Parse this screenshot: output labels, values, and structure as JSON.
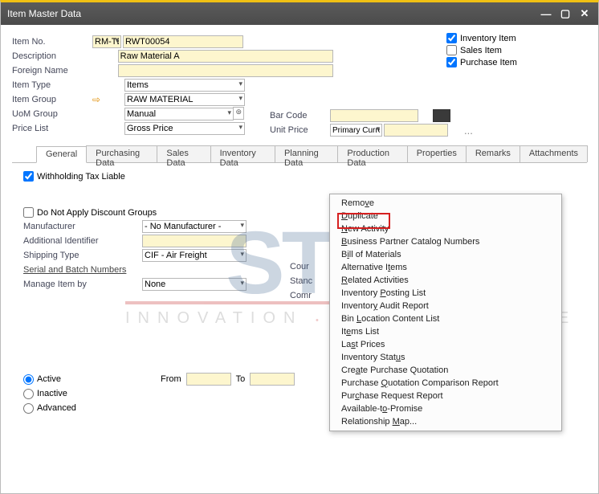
{
  "window": {
    "title": "Item Master Data"
  },
  "header": {
    "item_no_lbl": "Item No.",
    "item_no_prefix": "RM-TB",
    "item_no": "RWT00054",
    "desc_lbl": "Description",
    "desc": "Raw Material A",
    "foreign_lbl": "Foreign Name",
    "foreign": "",
    "type_lbl": "Item Type",
    "type": "Items",
    "group_lbl": "Item Group",
    "group": "RAW MATERIAL",
    "uom_lbl": "UoM Group",
    "uom": "Manual",
    "pricelist_lbl": "Price List",
    "pricelist": "Gross Price",
    "barcode_lbl": "Bar Code",
    "barcode": "",
    "unitprice_lbl": "Unit Price",
    "unitprice_cur": "Primary Curre",
    "unitprice": ""
  },
  "checks": {
    "inv_lbl": "Inventory Item",
    "sales_lbl": "Sales Item",
    "purch_lbl": "Purchase Item"
  },
  "tabs": {
    "general": "General",
    "purchasing": "Purchasing Data",
    "sales": "Sales Data",
    "inventory": "Inventory Data",
    "planning": "Planning Data",
    "production": "Production Data",
    "properties": "Properties",
    "remarks": "Remarks",
    "attachments": "Attachments"
  },
  "general": {
    "withhold_lbl": "Withholding Tax Liable",
    "nodisc_lbl": "Do Not Apply Discount Groups",
    "mfr_lbl": "Manufacturer",
    "mfr": "- No Manufacturer -",
    "addid_lbl": "Additional Identifier",
    "addid": "",
    "ship_lbl": "Shipping Type",
    "ship": "CIF - Air Freight",
    "serial_link": "Serial and Batch Numbers",
    "manage_lbl": "Manage Item by",
    "manage": "None",
    "active_lbl": "Active",
    "inactive_lbl": "Inactive",
    "advanced_lbl": "Advanced",
    "from_lbl": "From",
    "to_lbl": "To",
    "country_lbl": "Cour",
    "stand_lbl": "Stanc",
    "comm_lbl": "Comr"
  },
  "context_menu": {
    "items": [
      {
        "html": "Remo<u>v</u>e"
      },
      {
        "html": "<u>D</u>uplicate"
      },
      {
        "html": "<u>N</u>ew Activity"
      },
      {
        "html": "<u>B</u>usiness Partner Catalog Numbers"
      },
      {
        "html": "B<u>i</u>ll of Materials"
      },
      {
        "html": "Alternative I<u>t</u>ems"
      },
      {
        "html": "<u>R</u>elated Activities"
      },
      {
        "html": "Inventory <u>P</u>osting List"
      },
      {
        "html": "Inventor<u>y</u> Audit Report"
      },
      {
        "html": "Bin <u>L</u>ocation Content List"
      },
      {
        "html": "It<u>e</u>ms List"
      },
      {
        "html": "La<u>s</u>t Prices"
      },
      {
        "html": "Inventory Stat<u>u</u>s"
      },
      {
        "html": "Cre<u>a</u>te Purchase Quotation"
      },
      {
        "html": "Purchase <u>Q</u>uotation Comparison Report"
      },
      {
        "html": "Pur<u>c</u>hase Request Report"
      },
      {
        "html": "Available-t<u>o</u>-Promise"
      },
      {
        "html": "Relationship <u>M</u>ap..."
      }
    ]
  },
  "watermark": {
    "big": "STEM",
    "tag_html": "INNOVATION <span class='dot'>•</span> DESIGN <span class='dot'>•</span> VALUE",
    "reg": "®"
  }
}
